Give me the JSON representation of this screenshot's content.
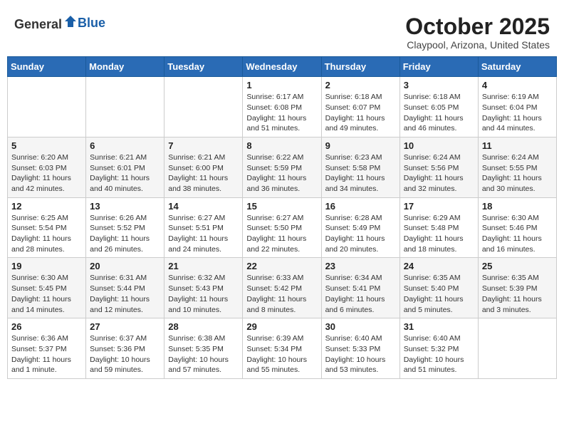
{
  "header": {
    "logo_general": "General",
    "logo_blue": "Blue",
    "month": "October 2025",
    "location": "Claypool, Arizona, United States"
  },
  "weekdays": [
    "Sunday",
    "Monday",
    "Tuesday",
    "Wednesday",
    "Thursday",
    "Friday",
    "Saturday"
  ],
  "weeks": [
    [
      {
        "day": "",
        "sunrise": "",
        "sunset": "",
        "daylight": ""
      },
      {
        "day": "",
        "sunrise": "",
        "sunset": "",
        "daylight": ""
      },
      {
        "day": "",
        "sunrise": "",
        "sunset": "",
        "daylight": ""
      },
      {
        "day": "1",
        "sunrise": "Sunrise: 6:17 AM",
        "sunset": "Sunset: 6:08 PM",
        "daylight": "Daylight: 11 hours and 51 minutes."
      },
      {
        "day": "2",
        "sunrise": "Sunrise: 6:18 AM",
        "sunset": "Sunset: 6:07 PM",
        "daylight": "Daylight: 11 hours and 49 minutes."
      },
      {
        "day": "3",
        "sunrise": "Sunrise: 6:18 AM",
        "sunset": "Sunset: 6:05 PM",
        "daylight": "Daylight: 11 hours and 46 minutes."
      },
      {
        "day": "4",
        "sunrise": "Sunrise: 6:19 AM",
        "sunset": "Sunset: 6:04 PM",
        "daylight": "Daylight: 11 hours and 44 minutes."
      }
    ],
    [
      {
        "day": "5",
        "sunrise": "Sunrise: 6:20 AM",
        "sunset": "Sunset: 6:03 PM",
        "daylight": "Daylight: 11 hours and 42 minutes."
      },
      {
        "day": "6",
        "sunrise": "Sunrise: 6:21 AM",
        "sunset": "Sunset: 6:01 PM",
        "daylight": "Daylight: 11 hours and 40 minutes."
      },
      {
        "day": "7",
        "sunrise": "Sunrise: 6:21 AM",
        "sunset": "Sunset: 6:00 PM",
        "daylight": "Daylight: 11 hours and 38 minutes."
      },
      {
        "day": "8",
        "sunrise": "Sunrise: 6:22 AM",
        "sunset": "Sunset: 5:59 PM",
        "daylight": "Daylight: 11 hours and 36 minutes."
      },
      {
        "day": "9",
        "sunrise": "Sunrise: 6:23 AM",
        "sunset": "Sunset: 5:58 PM",
        "daylight": "Daylight: 11 hours and 34 minutes."
      },
      {
        "day": "10",
        "sunrise": "Sunrise: 6:24 AM",
        "sunset": "Sunset: 5:56 PM",
        "daylight": "Daylight: 11 hours and 32 minutes."
      },
      {
        "day": "11",
        "sunrise": "Sunrise: 6:24 AM",
        "sunset": "Sunset: 5:55 PM",
        "daylight": "Daylight: 11 hours and 30 minutes."
      }
    ],
    [
      {
        "day": "12",
        "sunrise": "Sunrise: 6:25 AM",
        "sunset": "Sunset: 5:54 PM",
        "daylight": "Daylight: 11 hours and 28 minutes."
      },
      {
        "day": "13",
        "sunrise": "Sunrise: 6:26 AM",
        "sunset": "Sunset: 5:52 PM",
        "daylight": "Daylight: 11 hours and 26 minutes."
      },
      {
        "day": "14",
        "sunrise": "Sunrise: 6:27 AM",
        "sunset": "Sunset: 5:51 PM",
        "daylight": "Daylight: 11 hours and 24 minutes."
      },
      {
        "day": "15",
        "sunrise": "Sunrise: 6:27 AM",
        "sunset": "Sunset: 5:50 PM",
        "daylight": "Daylight: 11 hours and 22 minutes."
      },
      {
        "day": "16",
        "sunrise": "Sunrise: 6:28 AM",
        "sunset": "Sunset: 5:49 PM",
        "daylight": "Daylight: 11 hours and 20 minutes."
      },
      {
        "day": "17",
        "sunrise": "Sunrise: 6:29 AM",
        "sunset": "Sunset: 5:48 PM",
        "daylight": "Daylight: 11 hours and 18 minutes."
      },
      {
        "day": "18",
        "sunrise": "Sunrise: 6:30 AM",
        "sunset": "Sunset: 5:46 PM",
        "daylight": "Daylight: 11 hours and 16 minutes."
      }
    ],
    [
      {
        "day": "19",
        "sunrise": "Sunrise: 6:30 AM",
        "sunset": "Sunset: 5:45 PM",
        "daylight": "Daylight: 11 hours and 14 minutes."
      },
      {
        "day": "20",
        "sunrise": "Sunrise: 6:31 AM",
        "sunset": "Sunset: 5:44 PM",
        "daylight": "Daylight: 11 hours and 12 minutes."
      },
      {
        "day": "21",
        "sunrise": "Sunrise: 6:32 AM",
        "sunset": "Sunset: 5:43 PM",
        "daylight": "Daylight: 11 hours and 10 minutes."
      },
      {
        "day": "22",
        "sunrise": "Sunrise: 6:33 AM",
        "sunset": "Sunset: 5:42 PM",
        "daylight": "Daylight: 11 hours and 8 minutes."
      },
      {
        "day": "23",
        "sunrise": "Sunrise: 6:34 AM",
        "sunset": "Sunset: 5:41 PM",
        "daylight": "Daylight: 11 hours and 6 minutes."
      },
      {
        "day": "24",
        "sunrise": "Sunrise: 6:35 AM",
        "sunset": "Sunset: 5:40 PM",
        "daylight": "Daylight: 11 hours and 5 minutes."
      },
      {
        "day": "25",
        "sunrise": "Sunrise: 6:35 AM",
        "sunset": "Sunset: 5:39 PM",
        "daylight": "Daylight: 11 hours and 3 minutes."
      }
    ],
    [
      {
        "day": "26",
        "sunrise": "Sunrise: 6:36 AM",
        "sunset": "Sunset: 5:37 PM",
        "daylight": "Daylight: 11 hours and 1 minute."
      },
      {
        "day": "27",
        "sunrise": "Sunrise: 6:37 AM",
        "sunset": "Sunset: 5:36 PM",
        "daylight": "Daylight: 10 hours and 59 minutes."
      },
      {
        "day": "28",
        "sunrise": "Sunrise: 6:38 AM",
        "sunset": "Sunset: 5:35 PM",
        "daylight": "Daylight: 10 hours and 57 minutes."
      },
      {
        "day": "29",
        "sunrise": "Sunrise: 6:39 AM",
        "sunset": "Sunset: 5:34 PM",
        "daylight": "Daylight: 10 hours and 55 minutes."
      },
      {
        "day": "30",
        "sunrise": "Sunrise: 6:40 AM",
        "sunset": "Sunset: 5:33 PM",
        "daylight": "Daylight: 10 hours and 53 minutes."
      },
      {
        "day": "31",
        "sunrise": "Sunrise: 6:40 AM",
        "sunset": "Sunset: 5:32 PM",
        "daylight": "Daylight: 10 hours and 51 minutes."
      },
      {
        "day": "",
        "sunrise": "",
        "sunset": "",
        "daylight": ""
      }
    ]
  ]
}
